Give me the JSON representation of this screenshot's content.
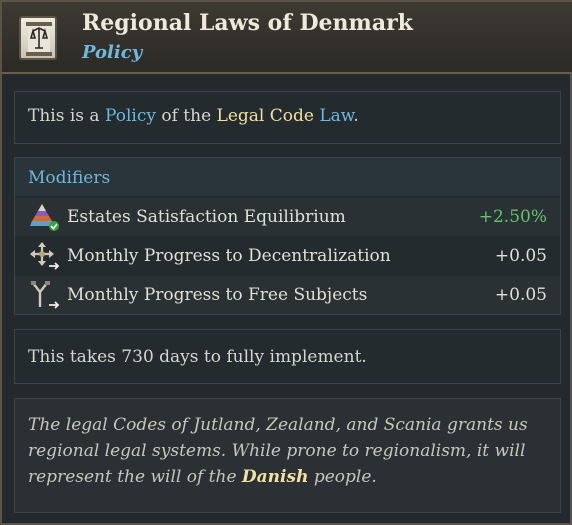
{
  "header": {
    "title": "Regional Laws of Denmark",
    "subtitle": "Policy",
    "icon": "policy-scroll-icon"
  },
  "intro": {
    "prefix": "This is a ",
    "policy_link": "Policy",
    "middle": " of the ",
    "law_name": "Legal Code",
    "law_link": "Law",
    "suffix": "."
  },
  "modifiers": {
    "title": "Modifiers",
    "rows": [
      {
        "icon": "estates-satisfaction-icon",
        "label": "Estates Satisfaction Equilibrium",
        "value": "+2.50%"
      },
      {
        "icon": "decentralization-arrows-icon",
        "label": "Monthly Progress to Decentralization",
        "value": "+0.05"
      },
      {
        "icon": "free-subjects-icon",
        "label": "Monthly Progress to Free Subjects",
        "value": "+0.05"
      }
    ]
  },
  "implementation": {
    "text": "This takes 730 days to fully implement."
  },
  "flavor": {
    "before": "The legal Codes of Jutland, Zealand, and Scania grants us regional legal systems. While prone to regionalism, it will represent the will of the ",
    "highlight": "Danish",
    "after": " people."
  },
  "colors": {
    "accent_blue": "#6fb8dc",
    "highlight_yellow": "#f1e0a3",
    "positive_green": "#63c36b"
  }
}
